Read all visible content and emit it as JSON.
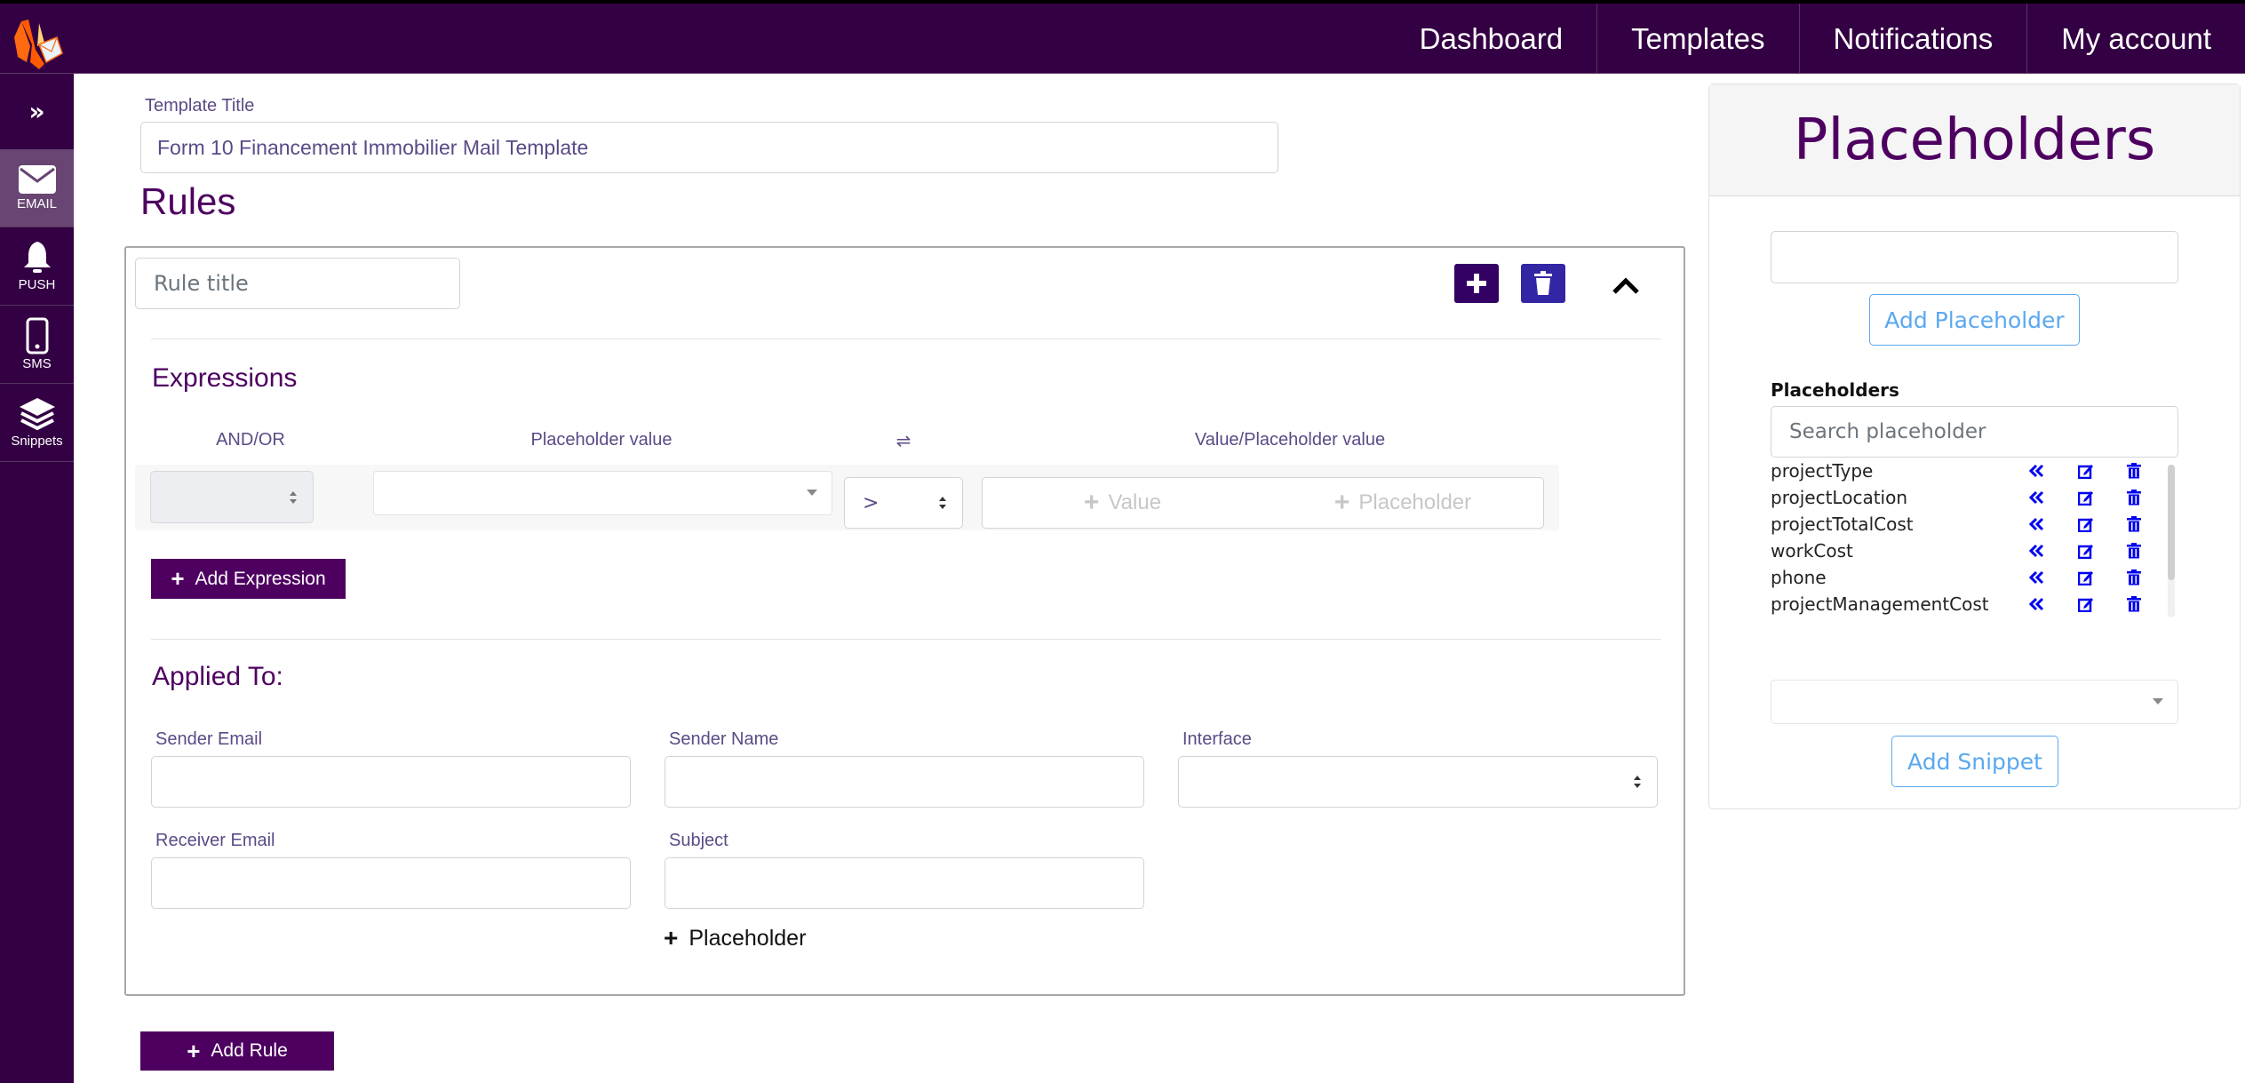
{
  "topbar": {
    "nav": [
      {
        "label": "Dashboard"
      },
      {
        "label": "Templates"
      },
      {
        "label": "Notifications"
      },
      {
        "label": "My account"
      }
    ]
  },
  "sidebar": {
    "toggle_icon": "»",
    "items": [
      {
        "label": "EMAIL",
        "icon": "envelope-icon",
        "active": true
      },
      {
        "label": "PUSH",
        "icon": "bell-icon",
        "active": false
      },
      {
        "label": "SMS",
        "icon": "mobile-icon",
        "active": false
      },
      {
        "label": "Snippets",
        "icon": "layers-icon",
        "active": false
      }
    ]
  },
  "template": {
    "title_label": "Template Title",
    "title_value": "Form 10 Financement Immobilier Mail Template"
  },
  "rules": {
    "heading": "Rules",
    "rule": {
      "title_placeholder": "Rule title",
      "expressions_heading": "Expressions",
      "columns": {
        "andor": "AND/OR",
        "placeholder_value": "Placeholder value",
        "swap": "⇌",
        "value_placeholder_value": "Value/Placeholder value"
      },
      "expression": {
        "andor_value": "",
        "placeholder_value": "",
        "operator": ">",
        "value_button": "Value",
        "placeholder_button": "Placeholder"
      },
      "add_expression_label": "Add Expression",
      "applied_to_heading": "Applied To:",
      "fields": {
        "sender_email": {
          "label": "Sender Email",
          "value": ""
        },
        "sender_name": {
          "label": "Sender Name",
          "value": ""
        },
        "interface": {
          "label": "Interface",
          "value": ""
        },
        "receiver_email": {
          "label": "Receiver Email",
          "value": ""
        },
        "subject": {
          "label": "Subject",
          "value": ""
        }
      },
      "add_placeholder_link": "Placeholder"
    },
    "add_rule_label": "Add Rule"
  },
  "placeholders_panel": {
    "title": "Placeholders",
    "new_placeholder_value": "",
    "add_placeholder_label": "Add Placeholder",
    "list_label": "Placeholders",
    "search_placeholder": "Search placeholder",
    "items": [
      {
        "name": "projectType"
      },
      {
        "name": "projectLocation"
      },
      {
        "name": "projectTotalCost"
      },
      {
        "name": "workCost"
      },
      {
        "name": "phone"
      },
      {
        "name": "projectManagementCost"
      }
    ],
    "snippet_value": "",
    "add_snippet_label": "Add Snippet",
    "icon_color": "#0000ee"
  },
  "colors": {
    "brand_dark": "#330043",
    "brand_purple": "#4e0060",
    "link_blue": "#5aa8f0"
  }
}
